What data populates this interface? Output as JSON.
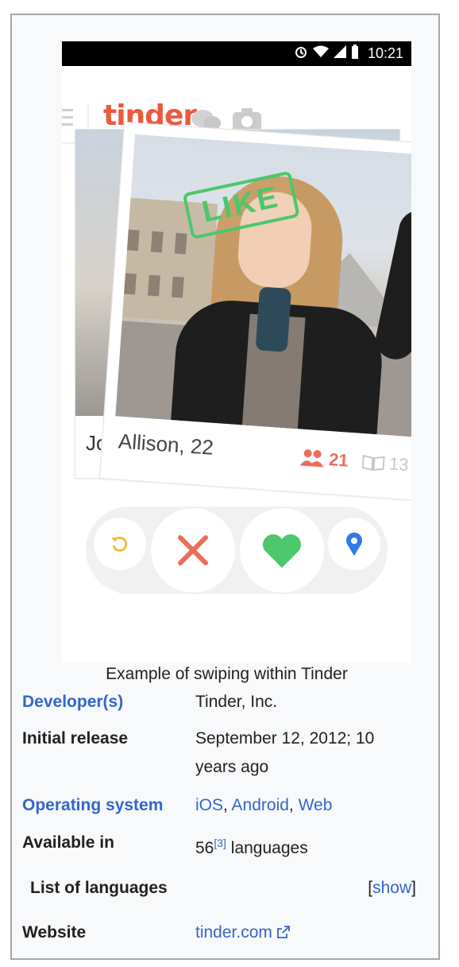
{
  "screenshot": {
    "status_time": "10:21",
    "app_logo": "tinder",
    "back_card_name": "Jo",
    "front_card_name": "Allison, 22",
    "like_stamp": "LIKE",
    "shared_friends": "21",
    "shared_interests": "13",
    "colors": {
      "brand": "#eb5a3e",
      "like": "#4cc76b",
      "nope": "#eb6e5a",
      "rewind": "#f0bd3a",
      "location": "#2f7be5"
    },
    "icons": [
      "hamburger-icon",
      "chat-bubbles-icon",
      "camera-icon",
      "friends-icon",
      "book-icon",
      "rewind-icon",
      "nope-x-icon",
      "heart-icon",
      "location-pin-icon"
    ]
  },
  "caption": "Example of swiping within Tinder",
  "rows": {
    "developer": {
      "label": "Developer(s)",
      "value": "Tinder, Inc."
    },
    "initial_release": {
      "label": "Initial release",
      "value_line1": "September 12, 2012; 10",
      "value_line2": "years ago"
    },
    "os": {
      "label": "Operating system",
      "ios": "iOS",
      "sep1": ", ",
      "android": "Android",
      "sep2": ", ",
      "web": "Web"
    },
    "available": {
      "label": "Available in",
      "count": "56",
      "ref": "[3]",
      "suffix": " languages"
    },
    "languages": {
      "label": "List of languages",
      "bracket_open": "[",
      "toggle": "show",
      "bracket_close": "]"
    },
    "website": {
      "label": "Website",
      "value": "tinder.com"
    }
  }
}
